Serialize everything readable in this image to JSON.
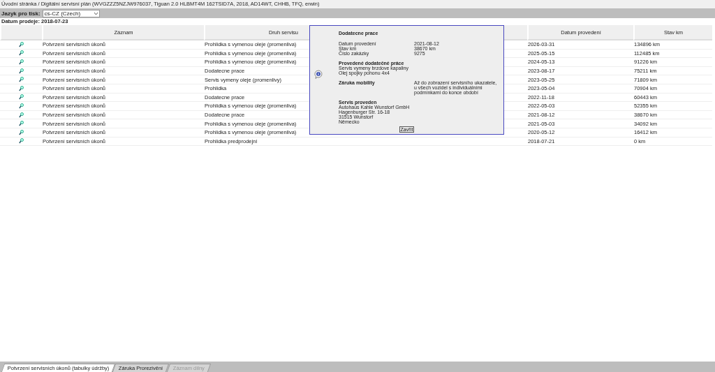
{
  "breadcrumb": "Úvodní stránka / Digitální servisní plán (WVGZZZ5NZJW976037, Tiguan 2.0 HLBMT4M 162TSID7A, 2018, AD14WT, CHHB, TFQ, erwin)",
  "language": {
    "label": "Jazyk pro tisk:",
    "value": "cs-CZ (Czech)"
  },
  "sale_date": "Datum prodeje: 2018-07-23",
  "table": {
    "columns": [
      "Záznam",
      "Druh servisu",
      "Datum provedení",
      "Stav km"
    ],
    "rows": [
      {
        "record": "Potvrzení servisních úkonů",
        "type": "Prohlidka s vymenou oleje (promenliva)",
        "date": "2026-03-31",
        "km": "134896 km"
      },
      {
        "record": "Potvrzení servisních úkonů",
        "type": "Prohlidka s vymenou oleje (promenliva)",
        "date": "2025-05-15",
        "km": "112485 km"
      },
      {
        "record": "Potvrzení servisních úkonů",
        "type": "Prohlidka s vymenou oleje (promenliva)",
        "date": "2024-05-13",
        "km": "91226 km"
      },
      {
        "record": "Potvrzení servisních úkonů",
        "type": "Dodatecne prace",
        "date": "2023-08-17",
        "km": "75211 km"
      },
      {
        "record": "Potvrzení servisních úkonů",
        "type": "Servis vymeny oleje (promenlivy)",
        "date": "2023-05-25",
        "km": "71809 km"
      },
      {
        "record": "Potvrzení servisních úkonů",
        "type": "Prohlidka",
        "date": "2023-05-04",
        "km": "70904 km"
      },
      {
        "record": "Potvrzení servisních úkonů",
        "type": "Dodatecne prace",
        "date": "2022-11-18",
        "km": "60443 km"
      },
      {
        "record": "Potvrzení servisních úkonů",
        "type": "Prohlidka s vymenou oleje (promenliva)",
        "date": "2022-05-03",
        "km": "52355 km"
      },
      {
        "record": "Potvrzení servisních úkonů",
        "type": "Dodatecne prace",
        "date": "2021-08-12",
        "km": "38670 km"
      },
      {
        "record": "Potvrzení servisních úkonů",
        "type": "Prohlidka s vymenou oleje (promenliva)",
        "date": "2021-05-03",
        "km": "34092 km"
      },
      {
        "record": "Potvrzení servisních úkonů",
        "type": "Prohlidka s vymenou oleje (promenliva)",
        "date": "2020-05-12",
        "km": "16412 km"
      },
      {
        "record": "Potvrzení servisních úkonů",
        "type": "Prohlidka predprodejni",
        "date": "2018-07-21",
        "km": "0 km"
      }
    ]
  },
  "dialog": {
    "title": "Dodatecne prace",
    "fields": [
      {
        "label": "Datum provedení",
        "value": "2021-08-12"
      },
      {
        "label": "Stav km",
        "value": "38670 km"
      },
      {
        "label": "Číslo zakázky",
        "value": "9275"
      }
    ],
    "work_heading": "Provedené dodatečné práce",
    "work_items": [
      "Servis vymeny brzdove kapaliny",
      "Olej spojky pohonu 4x4"
    ],
    "mobility": {
      "label": "Záruka mobility",
      "value": "Až do zobrazení servisního ukazatele, u všech vozidel s individuálními podmínkami do konce období"
    },
    "performed_heading": "Servis proveden",
    "address": [
      "Autohaus Kahle Wunstorf GmbH",
      "Hagenburger Str. 16-18",
      "31515 Wunstorf",
      "Německo"
    ],
    "close": "Zavřít"
  },
  "tabs": [
    {
      "label": "Potvrzení servisních úkonů (tabulky údržby)",
      "selected": true,
      "disabled": false
    },
    {
      "label": "Záruka Prorezivění",
      "selected": false,
      "disabled": false
    },
    {
      "label": "Záznam dílny",
      "selected": false,
      "disabled": true
    }
  ]
}
